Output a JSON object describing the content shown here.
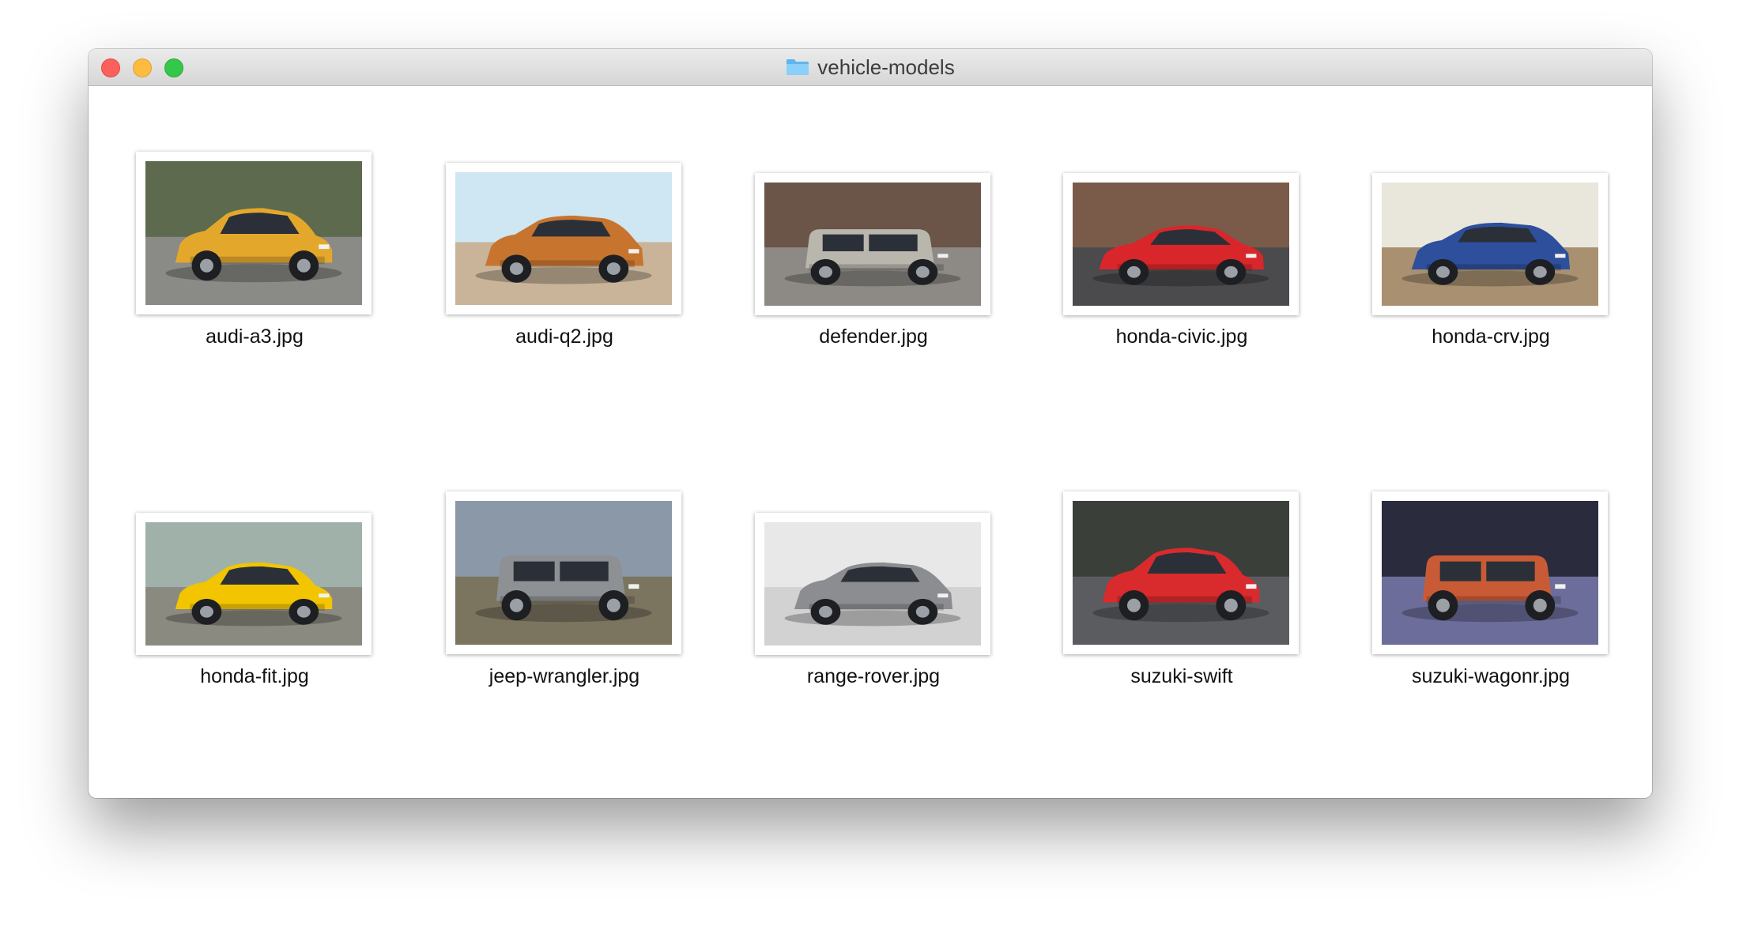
{
  "window": {
    "title": "vehicle-models"
  },
  "files": [
    {
      "name": "audi-a3.jpg",
      "thumb": {
        "sky": "#5d6a4e",
        "ground": "#8a8a86",
        "car": "#e3a82b",
        "type": "hatch"
      }
    },
    {
      "name": "audi-q2.jpg",
      "thumb": {
        "sky": "#cfe6f3",
        "ground": "#c9b49a",
        "car": "#c7752e",
        "type": "suv"
      }
    },
    {
      "name": "defender.jpg",
      "thumb": {
        "sky": "#6a5548",
        "ground": "#8d8a86",
        "car": "#b9b6ae",
        "type": "boxy"
      }
    },
    {
      "name": "honda-civic.jpg",
      "thumb": {
        "sky": "#7a5b4a",
        "ground": "#4b4a4c",
        "car": "#d9262b",
        "type": "sedan"
      }
    },
    {
      "name": "honda-crv.jpg",
      "thumb": {
        "sky": "#e9e6dc",
        "ground": "#a89070",
        "car": "#2d4f9c",
        "type": "suv"
      }
    },
    {
      "name": "honda-fit.jpg",
      "thumb": {
        "sky": "#9fb1a9",
        "ground": "#8a8a80",
        "car": "#f2c500",
        "type": "hatch"
      }
    },
    {
      "name": "jeep-wrangler.jpg",
      "thumb": {
        "sky": "#8a98a8",
        "ground": "#7b7560",
        "car": "#8e9193",
        "type": "boxy"
      }
    },
    {
      "name": "range-rover.jpg",
      "thumb": {
        "sky": "#e8e8e8",
        "ground": "#d2d2d2",
        "car": "#8b8d90",
        "type": "suv"
      }
    },
    {
      "name": "suzuki-swift",
      "thumb": {
        "sky": "#3b3f3a",
        "ground": "#5b5c60",
        "car": "#d92a2d",
        "type": "hatch"
      }
    },
    {
      "name": "suzuki-wagonr.jpg",
      "thumb": {
        "sky": "#2a2b3d",
        "ground": "#6c6d9a",
        "car": "#c85b36",
        "type": "boxy"
      }
    }
  ]
}
